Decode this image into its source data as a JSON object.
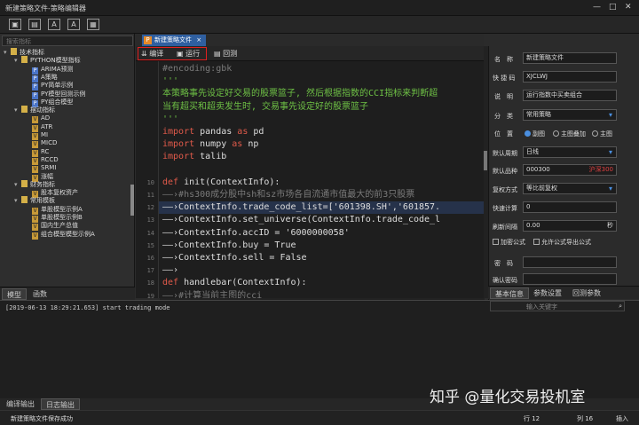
{
  "window": {
    "title": "新建策略文件-策略编辑器",
    "min": "—",
    "max": "□",
    "close": "✕"
  },
  "toolbar": {
    "buttons": [
      "▣",
      "▤",
      "A",
      "A",
      "▦"
    ]
  },
  "left": {
    "search_placeholder": "搜索指标",
    "tree": [
      {
        "d": 0,
        "ic": "f",
        "ar": "▾",
        "label": "技术指标"
      },
      {
        "d": 1,
        "ic": "f",
        "ar": "▾",
        "label": "PYTHON模型指标"
      },
      {
        "d": 2,
        "ic": "p",
        "ar": "",
        "label": "ARIMA预测"
      },
      {
        "d": 2,
        "ic": "p",
        "ar": "",
        "label": "A策略"
      },
      {
        "d": 2,
        "ic": "p",
        "ar": "",
        "label": "PY简单示例"
      },
      {
        "d": 2,
        "ic": "p",
        "ar": "",
        "label": "PY模型回测示例"
      },
      {
        "d": 2,
        "ic": "p",
        "ar": "",
        "label": "PY组合模型"
      },
      {
        "d": 1,
        "ic": "f",
        "ar": "▾",
        "label": "摆动指标"
      },
      {
        "d": 2,
        "ic": "v",
        "ar": "",
        "label": "AD"
      },
      {
        "d": 2,
        "ic": "v",
        "ar": "",
        "label": "ATR"
      },
      {
        "d": 2,
        "ic": "v",
        "ar": "",
        "label": "MI"
      },
      {
        "d": 2,
        "ic": "v",
        "ar": "",
        "label": "MICD"
      },
      {
        "d": 2,
        "ic": "v",
        "ar": "",
        "label": "RC"
      },
      {
        "d": 2,
        "ic": "v",
        "ar": "",
        "label": "RCCD"
      },
      {
        "d": 2,
        "ic": "v",
        "ar": "",
        "label": "SRMI"
      },
      {
        "d": 2,
        "ic": "v",
        "ar": "",
        "label": "涨幅"
      },
      {
        "d": 1,
        "ic": "f",
        "ar": "▾",
        "label": "财务指标"
      },
      {
        "d": 2,
        "ic": "v",
        "ar": "",
        "label": "股本复权资产"
      },
      {
        "d": 1,
        "ic": "f",
        "ar": "▾",
        "label": "常用模板"
      },
      {
        "d": 2,
        "ic": "v",
        "ar": "",
        "label": "单股模型示例A"
      },
      {
        "d": 2,
        "ic": "v",
        "ar": "",
        "label": "单股模型示例B"
      },
      {
        "d": 2,
        "ic": "v",
        "ar": "",
        "label": "国内生产总值"
      },
      {
        "d": 2,
        "ic": "v",
        "ar": "",
        "label": "组合模型模型示例A"
      }
    ],
    "tabs": [
      "模型",
      "函数"
    ]
  },
  "editor": {
    "tab_label": "新建策略文件",
    "tab_close": "×",
    "compile": "编译",
    "run": "运行",
    "backtest": "回测",
    "lines": [
      {
        "n": "",
        "t": "#encoding:gbk",
        "c": "#7a7a7a"
      },
      {
        "n": "",
        "t": "'''",
        "c": "#6ec045"
      },
      {
        "n": "",
        "t": "本策略事先设定好交易的股票篮子, 然后根据指数的CCI指标来判断超",
        "c": "#6ec045"
      },
      {
        "n": "",
        "t": "当有超买和超卖发生时, 交易事先设定好的股票篮子",
        "c": "#6ec045"
      },
      {
        "n": "",
        "t": "'''",
        "c": "#6ec045"
      },
      {
        "n": "",
        "t": "import pandas as pd",
        "c": "#ddd",
        "kw": "import",
        "kw2": "as"
      },
      {
        "n": "",
        "t": "import numpy as np",
        "c": "#ddd",
        "kw": "import",
        "kw2": "as"
      },
      {
        "n": "",
        "t": "import talib",
        "c": "#ddd",
        "kw": "import"
      },
      {
        "n": "",
        "t": "",
        "c": "#ddd"
      },
      {
        "n": "10",
        "t": "def init(ContextInfo):",
        "c": "#ddd",
        "kw": "def"
      },
      {
        "n": "11",
        "t": "——›#hs300成分股中sh和sz市场各自流通市值最大的前3只股票",
        "c": "#7a7a7a"
      },
      {
        "n": "12",
        "t": "——›ContextInfo.trade_code_list=['601398.SH','601857.",
        "c": "#ddd",
        "hl": true
      },
      {
        "n": "13",
        "t": "——›ContextInfo.set_universe(ContextInfo.trade_code_l",
        "c": "#ddd"
      },
      {
        "n": "14",
        "t": "——›ContextInfo.accID = '6000000058'",
        "c": "#ddd"
      },
      {
        "n": "15",
        "t": "——›ContextInfo.buy = True",
        "c": "#ddd"
      },
      {
        "n": "16",
        "t": "——›ContextInfo.sell = False",
        "c": "#ddd"
      },
      {
        "n": "17",
        "t": "——›",
        "c": "#ddd"
      },
      {
        "n": "18",
        "t": "def handlebar(ContextInfo):",
        "c": "#ddd",
        "kw": "def"
      },
      {
        "n": "19",
        "t": "——›#计算当前主图的cci",
        "c": "#7a7a7a"
      },
      {
        "n": "20",
        "t": "——›index_hs300 = ContextInfo.get_history_data(['idx']",
        "c": "#ddd"
      }
    ]
  },
  "props": {
    "name_label": "名　称",
    "name_value": "新建策略文件",
    "shortcode_label": "快 捷 码",
    "shortcode_value": "XJCLWJ",
    "desc_label": "说　明",
    "desc_value": "运行指数中买卖组合",
    "cat_label": "分　类",
    "cat_value": "常用策略",
    "pos_label": "位　置",
    "pos_opts": [
      "副图",
      "主图叠加",
      "主图"
    ],
    "period_label": "默认周期",
    "period_value": "日线",
    "stock_label": "默认品种",
    "stock_value": "000300",
    "stock_tag": "沪深300",
    "adj_label": "复权方式",
    "adj_value": "等比前复权",
    "fast_label": "快速计算",
    "fast_value": "0",
    "refresh_label": "刷新间隔",
    "refresh_value": "0.00",
    "refresh_unit": "秒",
    "encrypt": "加密公式",
    "allow_export": "允许公式导出公式",
    "pwd_label": "密　码",
    "pwd2_label": "确认密码",
    "tabs": [
      "基本信息",
      "参数设置",
      "回测参数"
    ]
  },
  "bottom": {
    "log": "[2019-06-13 18:29:21.653]   start trading mode",
    "kw_placeholder": "输入关键字",
    "tabs": [
      "编译输出",
      "日志输出"
    ]
  },
  "status": {
    "msg": "新建策略文件保存成功",
    "row": "行 12",
    "col": "列 16",
    "insert": "插入"
  },
  "watermark": "知乎 @量化交易投机室"
}
